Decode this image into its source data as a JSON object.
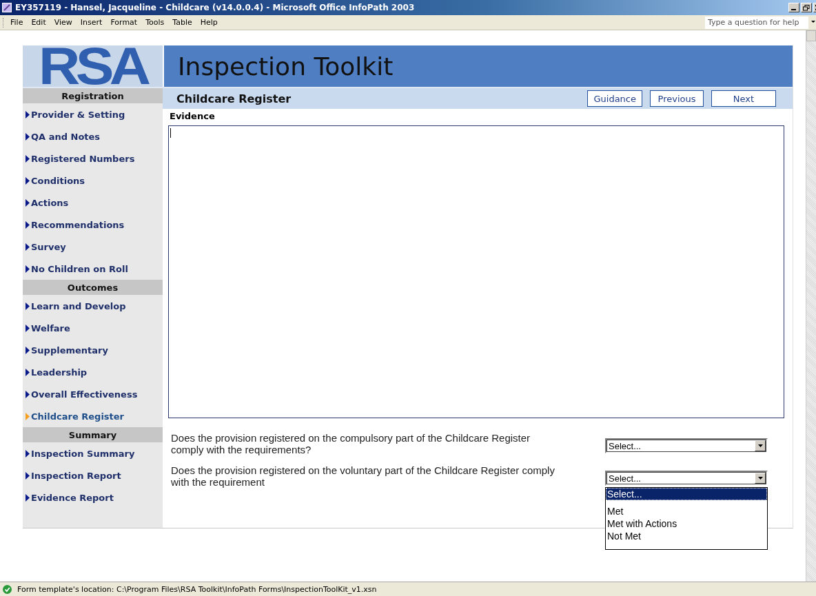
{
  "window": {
    "title": "EY357119 - Hansel, Jacqueline - Childcare   (v14.0.0.4) - Microsoft Office InfoPath 2003"
  },
  "menu": [
    "File",
    "Edit",
    "View",
    "Insert",
    "Format",
    "Tools",
    "Table",
    "Help"
  ],
  "help_box": {
    "placeholder": "Type a question for help"
  },
  "logo": "RSA",
  "banner": "Inspection Toolkit",
  "sidebar": {
    "sections": [
      {
        "heading": "Registration",
        "items": [
          {
            "label": "Provider & Setting",
            "selected": false
          },
          {
            "label": "QA and Notes",
            "selected": false
          },
          {
            "label": "Registered Numbers",
            "selected": false
          },
          {
            "label": "Conditions",
            "selected": false
          },
          {
            "label": "Actions",
            "selected": false
          },
          {
            "label": "Recommendations",
            "selected": false
          },
          {
            "label": "Survey",
            "selected": false
          },
          {
            "label": "No Children on Roll",
            "selected": false
          }
        ]
      },
      {
        "heading": "Outcomes",
        "items": [
          {
            "label": "Learn and Develop",
            "selected": false
          },
          {
            "label": "Welfare",
            "selected": false
          },
          {
            "label": "Supplementary",
            "selected": false
          },
          {
            "label": "Leadership",
            "selected": false
          },
          {
            "label": "Overall Effectiveness",
            "selected": false
          },
          {
            "label": "Childcare Register",
            "selected": true
          }
        ]
      },
      {
        "heading": "Summary",
        "items": [
          {
            "label": "Inspection Summary",
            "selected": false
          },
          {
            "label": "Inspection Report",
            "selected": false
          },
          {
            "label": "Evidence Report",
            "selected": false
          }
        ]
      }
    ]
  },
  "page": {
    "title": "Childcare Register",
    "buttons": [
      "Guidance",
      "Previous",
      "Next"
    ],
    "evidence_label": "Evidence",
    "questions": [
      {
        "text": "Does the provision registered on the compulsory part of the Childcare Register comply with the requirements?",
        "value": "Select..."
      },
      {
        "text": "Does the provision registered on the voluntary part of the Childcare Register comply with the requirement",
        "value": "Select...",
        "options": [
          {
            "label": "Select...",
            "selected": true
          },
          {
            "label": "Met",
            "selected": false
          },
          {
            "label": "Met with Actions",
            "selected": false
          },
          {
            "label": "Not Met",
            "selected": false
          }
        ]
      }
    ]
  },
  "status_bar": "Form template's location: C:\\Program Files\\RSA Toolkit\\InfoPath Forms\\InspectionToolKit_v1.xsn"
}
